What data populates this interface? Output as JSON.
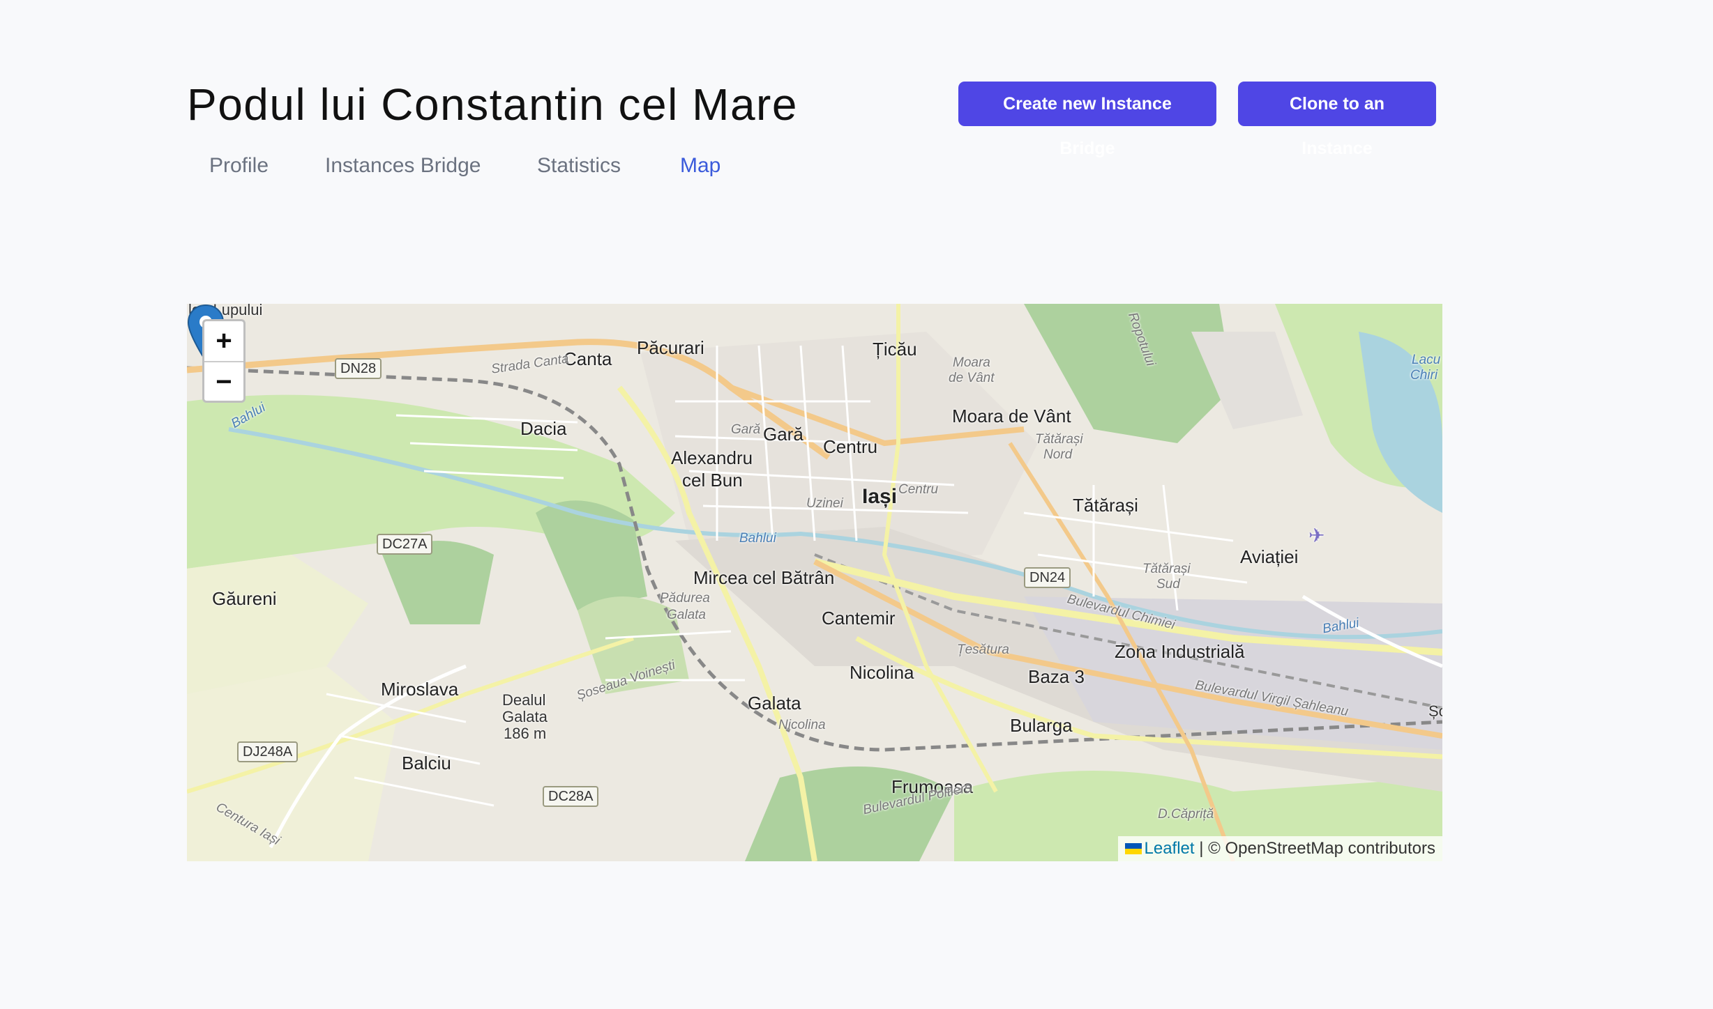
{
  "header": {
    "title": "Podul lui Constantin cel Mare",
    "create_button": "Create new Instance Bridge",
    "clone_button": "Clone to an Instance"
  },
  "tabs": [
    {
      "label": "Profile",
      "active": false
    },
    {
      "label": "Instances Bridge",
      "active": false
    },
    {
      "label": "Statistics",
      "active": false
    },
    {
      "label": "Map",
      "active": true
    }
  ],
  "map": {
    "zoom_in": "+",
    "zoom_out": "−",
    "attribution_link": "Leaflet",
    "attribution_text": "| © OpenStreetMap contributors",
    "labels": {
      "iasi": "Iași",
      "pacurari": "Păcurari",
      "ticau": "Țicău",
      "canta": "Canta",
      "strada_canta": "Strada Canta",
      "dacia": "Dacia",
      "gara": "Gară",
      "gara_small": "Gară",
      "centru": "Centru",
      "centru_small": "Centru",
      "alexandru": "Alexandru",
      "cel_bun": "cel Bun",
      "uzinei": "Uzinei",
      "bahlui_1": "Bahlui",
      "bahlui_2": "Bahlui",
      "bahlui_3": "Bahlui",
      "mircea": "Mircea cel Bătrân",
      "cantemir": "Cantemir",
      "padurea": "Pădurea",
      "galata_small": "Galata",
      "nicolina": "Nicolina",
      "nicolina_small": "Nicolina",
      "galata": "Galata",
      "moara_de_vant": "Moara de Vânt",
      "moara_small": "Moara",
      "de_vant_small": "de Vânt",
      "tatarasi": "Tătărași",
      "tatarasi_nord_1": "Tătărași",
      "tatarasi_nord_2": "Nord",
      "tatarasi_sud_1": "Tătărași",
      "tatarasi_sud_2": "Sud",
      "aviatiei": "Aviației",
      "zona_industriala": "Zona Industrială",
      "baza3": "Baza 3",
      "bularga": "Bularga",
      "frumoasa": "Frumoasa",
      "d_caprita": "D.Căpriță",
      "gaureni": "Găureni",
      "miroslava": "Miroslava",
      "balciu": "Balciu",
      "dealul": "Dealul",
      "galata_hill": "Galata",
      "hill_height": "186 m",
      "lea_lupului": "lea Lupului",
      "lacu_1": "Lacu",
      "lacu_2": "Chiri",
      "bd_chimiei": "Bulevardul Chimiei",
      "bd_sahleanu": "Bulevardul Virgil Șahleanu",
      "bd_poitiers": "Bulevardul Poitiers",
      "sos_voinesti": "Șoseaua Voinești",
      "centura": "Centura Iași",
      "tesatura": "Țesătura",
      "ropotului": "Ropotului",
      "so": "Șo"
    },
    "shields": {
      "dn28": "DN28",
      "dc27a": "DC27A",
      "dn24": "DN24",
      "dj248a": "DJ248A",
      "dc28a": "DC28A"
    },
    "colors": {
      "marker": "#2a7bc8",
      "forest": "#add19e",
      "water": "#aad3df",
      "major_road": "#f8d69a",
      "primary_road": "#f4f2a6"
    }
  }
}
